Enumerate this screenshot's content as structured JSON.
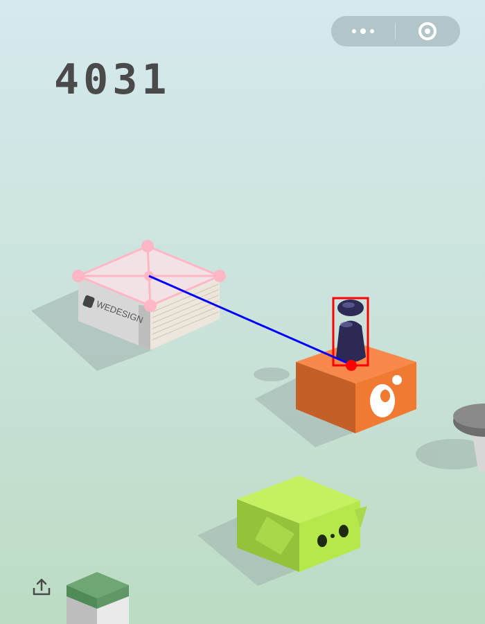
{
  "game": {
    "score": "4031",
    "block_label": "WEDESIGN"
  },
  "menu": {
    "more_icon": "more-dots-icon",
    "close_icon": "target-ring-icon"
  },
  "share": {
    "icon": "share-upload-icon"
  },
  "colors": {
    "score": "#4a4a4a",
    "orange_block": "#f07a32",
    "green_block": "#b5e84a",
    "player": "#2c2a55",
    "overlay_outline": "#ffb7c5",
    "bbox": "#ff0000",
    "trajectory": "#0000ff"
  }
}
